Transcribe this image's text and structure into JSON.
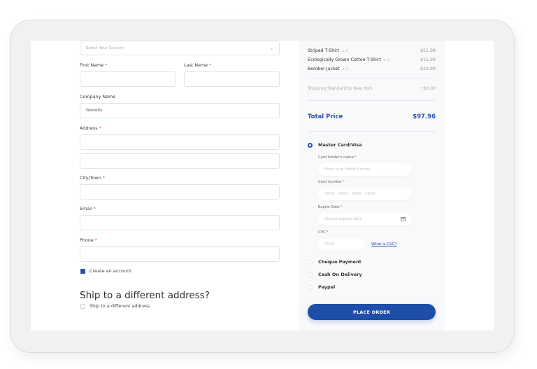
{
  "billing": {
    "country_placeholder": "Select Your Country",
    "first_name_label": "First Name",
    "last_name_label": "Last Name",
    "company_label": "Company Name",
    "company_value": "Woostify",
    "address_label": "Address",
    "city_label": "City/Town",
    "email_label": "Email",
    "phone_label": "Phone",
    "required_marker": "*",
    "create_account_label": "Create an account",
    "create_account_checked": true
  },
  "shipping": {
    "title": "Ship to a different address?",
    "checkbox_label": "Ship to a different address",
    "checked": false
  },
  "order": {
    "items": [
      {
        "name": "Striped T-Shirt",
        "qty": "x 2",
        "price": "$51.98"
      },
      {
        "name": "Ecologically Grown Cotton T-Shirt",
        "qty": "x 1",
        "price": "$15.99"
      },
      {
        "name": "Bomber Jacket",
        "qty": "x 1",
        "price": "$29.99"
      }
    ],
    "shipping_label": "Shipping Standard to New York",
    "shipping_price": "+$0.00",
    "total_label": "Total Price",
    "total_value": "$97.96"
  },
  "payment": {
    "methods": [
      {
        "label": "Master Card/Visa",
        "selected": true
      },
      {
        "label": "Cheque Payment",
        "selected": false
      },
      {
        "label": "Cash On Delivery",
        "selected": false
      },
      {
        "label": "Paypal",
        "selected": false
      }
    ],
    "card_holder_label": "Card holder's name",
    "card_holder_placeholder": "Enter card holder's name",
    "card_number_label": "Card number",
    "card_number_placeholder": "XXXX - XXXX - XXXX - XXXX",
    "expire_label": "Expire Date",
    "expire_placeholder": "Choose expired date",
    "cvc_label": "CVC",
    "cvc_placeholder": "XXXX",
    "cvc_help": "What is CVC?",
    "required_marker": "*",
    "place_order_label": "PLACE ORDER"
  },
  "colors": {
    "accent": "#2a51b1",
    "button": "#1f4ea8",
    "required": "#e05050"
  }
}
